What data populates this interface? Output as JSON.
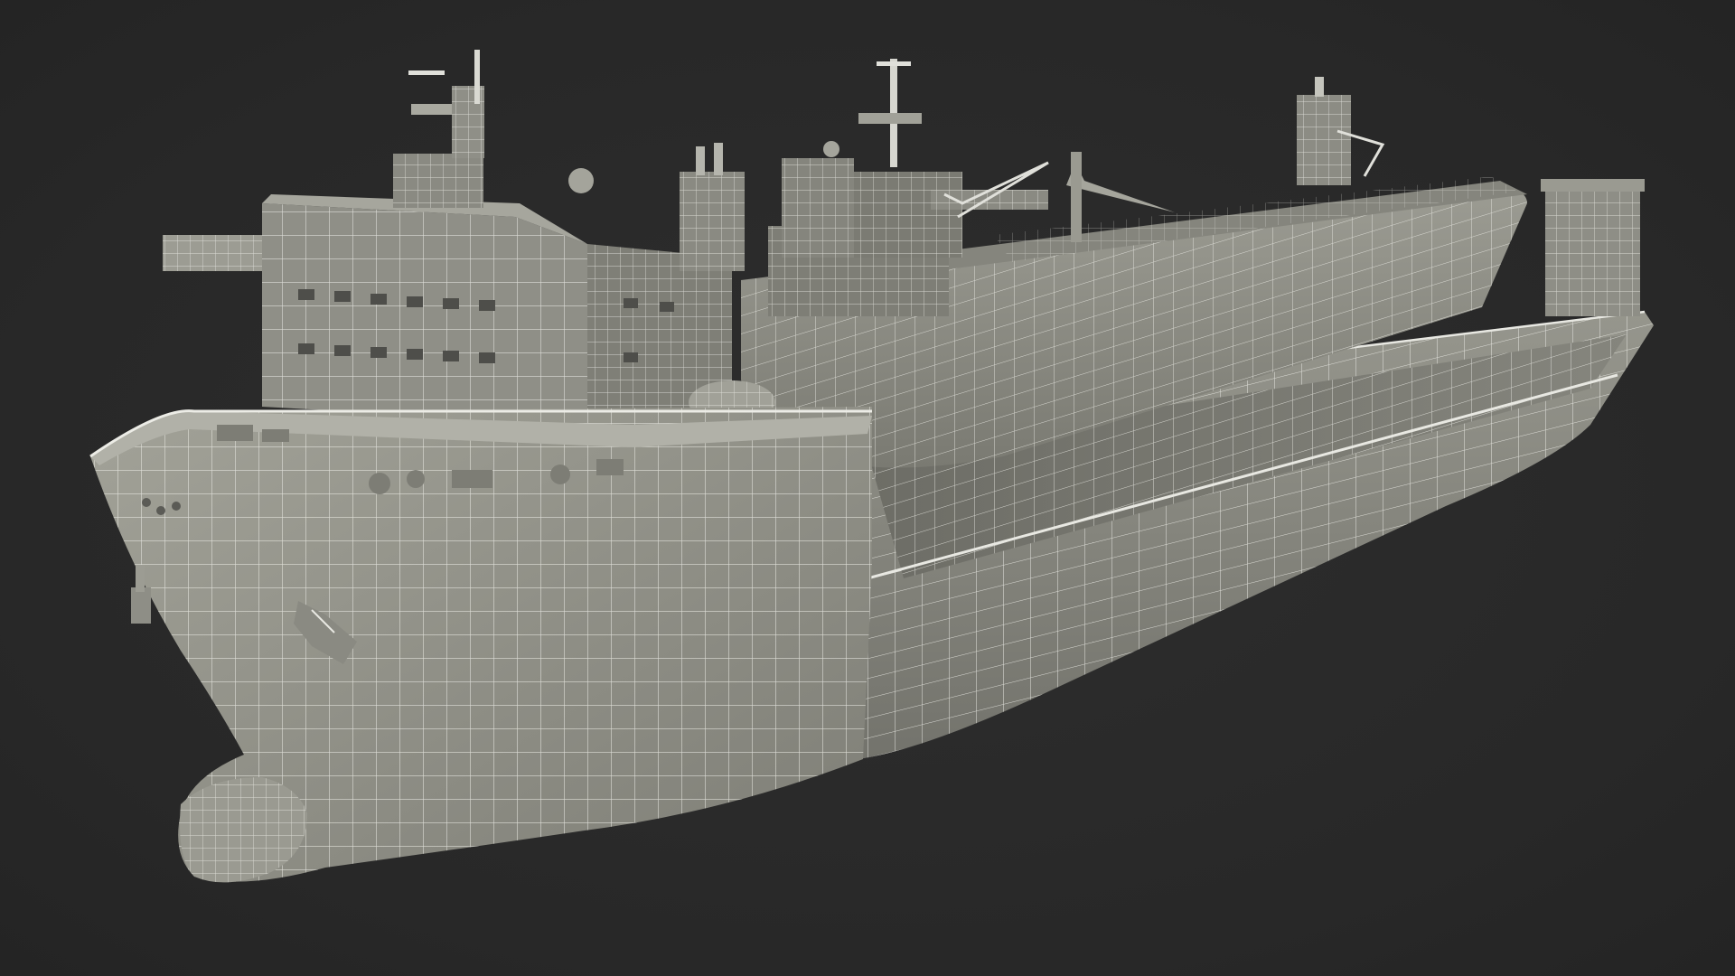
{
  "scene": {
    "subject": "ship-wireframe-render",
    "colors": {
      "background": "#2a2a2a",
      "hull_fill": "#8d8d84",
      "hull_shadow": "#6f6f68",
      "hull_light": "#a3a39a",
      "deck_fill": "#7c7c74",
      "wire": "#e8e8e2",
      "detail": "#5a5a55"
    }
  }
}
